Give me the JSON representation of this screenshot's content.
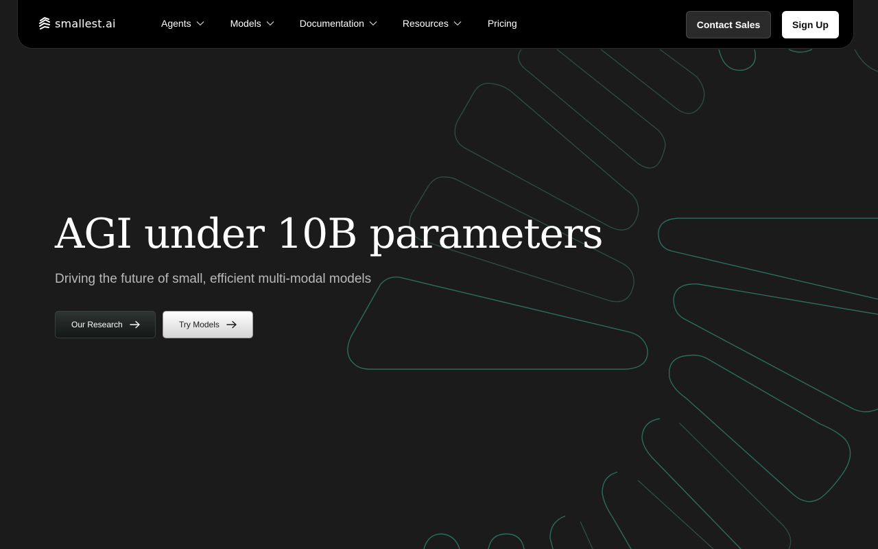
{
  "brand": {
    "name": "smallest.ai",
    "logo_icon": "smallest-logo-icon"
  },
  "nav": {
    "items": [
      {
        "label": "Agents",
        "icon": "chevron-down-icon"
      },
      {
        "label": "Models",
        "icon": "chevron-down-icon"
      },
      {
        "label": "Documentation",
        "icon": "chevron-down-icon"
      },
      {
        "label": "Resources",
        "icon": "chevron-down-icon"
      },
      {
        "label": "Pricing"
      }
    ],
    "contact_label": "Contact Sales",
    "signup_label": "Sign Up"
  },
  "hero": {
    "title": "AGI under 10B parameters",
    "subtitle": "Driving the future of small, efficient multi-modal models",
    "buttons": [
      {
        "label": "Our Research",
        "icon": "arrow-right-icon"
      },
      {
        "label": "Try Models",
        "icon": "arrow-right-icon"
      }
    ]
  },
  "colors": {
    "background": "#1b1b1b",
    "nav_background": "#000000",
    "accent_stroke": "#2d6b5e",
    "subtitle_text": "#b9b9b9"
  }
}
